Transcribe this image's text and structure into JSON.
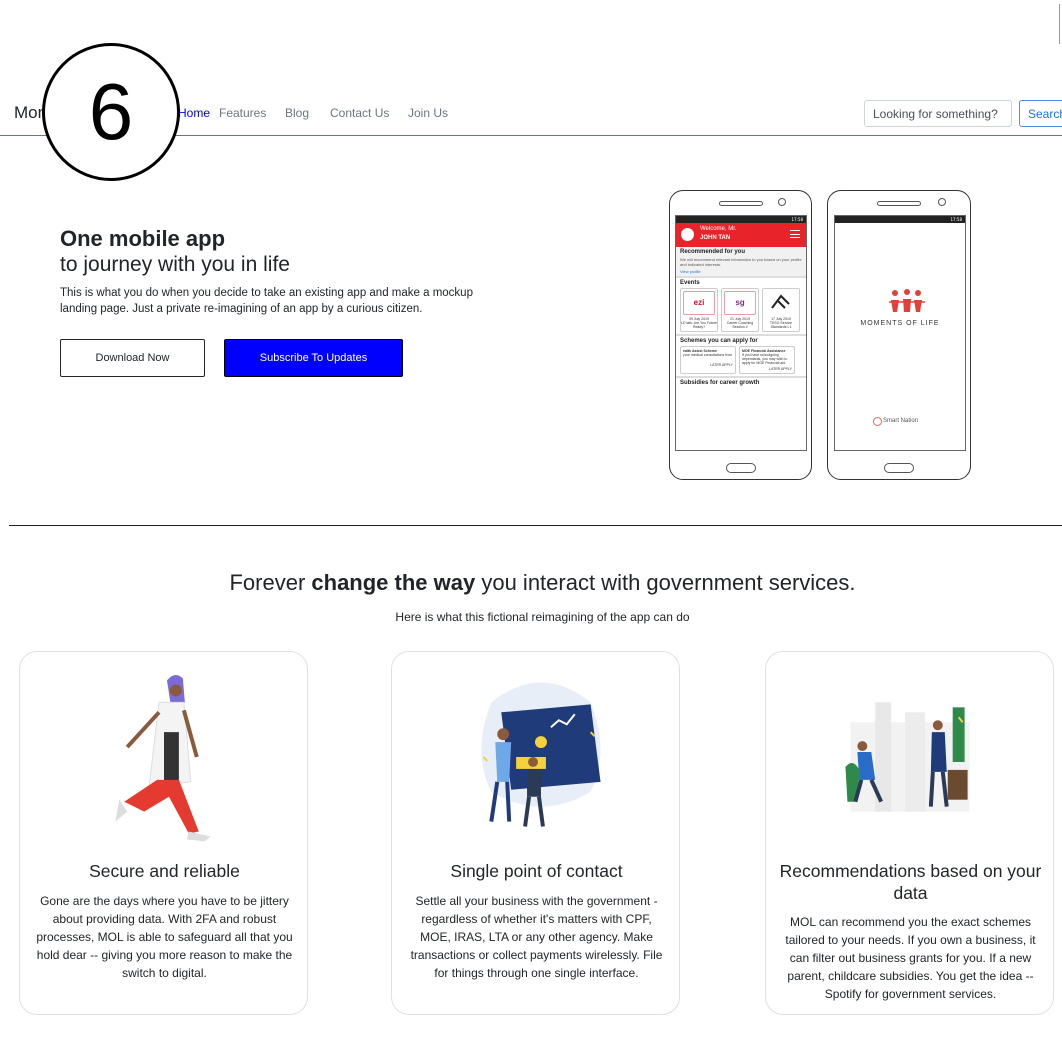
{
  "step_badge": "6",
  "navbar": {
    "brand": "Moments of Life",
    "links": [
      "Home",
      "Features",
      "Blog",
      "Contact Us",
      "Join Us"
    ],
    "search_placeholder": "Looking for something?",
    "search_button": "Search"
  },
  "hero": {
    "title_bold": "One mobile app",
    "title_rest": "to journey with you in life",
    "description": "This is what you do when you decide to take an existing app and make a mockup landing page. Just a private re-imagining of an app by a curious citizen.",
    "download_label": "Download Now",
    "subscribe_label": "Subscribe To Updates"
  },
  "phone_left": {
    "status": "17:58",
    "welcome": "Welcome, Mr.",
    "user": "JOHN TAN",
    "recommended_title": "Recommended for you",
    "recommended_text": "We will recommend relevant information to you based on your profile and indicated interests.",
    "view_profile": "View profile",
    "events_title": "Events",
    "events": [
      {
        "logo": "ezi",
        "date": "09 July 2019",
        "name": "LD talk: Are You Future Ready?"
      },
      {
        "logo": "sg",
        "date": "21 July 2019",
        "name": "Career Coaching Session 2"
      },
      {
        "logo": "",
        "date": "17 July 2019",
        "name": "TKSG Service Standards L1"
      }
    ],
    "schemes_title": "Schemes you can apply for",
    "schemes": [
      {
        "name": "ealth Assist Scheme",
        "text": "your medical consultations from",
        "actions": "LATER   APPLY"
      },
      {
        "name": "MOE Financial Assistance",
        "text": "If you have schoolgoing dependants, you may wish to apply for MOE Financial aid.",
        "actions": "LATER   APPLY"
      }
    ],
    "subsidies_title": "Subsidies for career growth"
  },
  "phone_right": {
    "status": "17:58",
    "app_name": "MOMENTS OF LIFE",
    "smart_nation": "Smart Nation"
  },
  "features": {
    "title_pre": "Forever ",
    "title_bold": "change the way",
    "title_post": " you interact with government services.",
    "subtitle": "Here is what this fictional reimagining of the app can do",
    "cards": [
      {
        "title": "Secure and reliable",
        "text": "Gone are the days where you have to be jittery about providing data. With 2FA and robust processes, MOL is able to safeguard all that you hold dear -- giving you more reason to make the switch to digital."
      },
      {
        "title": "Single point of contact",
        "text": "Settle all your business with the government - regardless of whether it's matters with CPF, MOE, IRAS, LTA or any other agency. Make transactions or collect payments wirelessly. File for things through one single interface."
      },
      {
        "title": "Recommendations based on your data",
        "text": "MOL can recommend you the exact schemes tailored to your needs. If you own a business, it can filter out business grants for you. If a new parent, childcare subsidies. You get the idea -- Spotify for government services."
      }
    ]
  }
}
